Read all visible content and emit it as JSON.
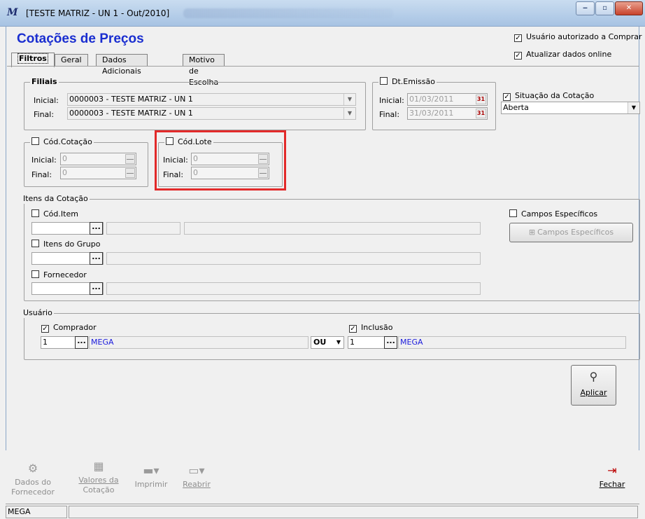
{
  "window": {
    "title": "[TESTE MATRIZ - UN 1 - Out/2010]",
    "buttons": {
      "minimize": "‒",
      "maximize": "▫",
      "close": "✕"
    }
  },
  "page": {
    "heading": "Cotações de Preços"
  },
  "top_right": {
    "usuario_autorizado": {
      "label": "Usuário autorizado a Comprar",
      "checked": true,
      "mark": "✓"
    },
    "atualizar_online": {
      "label": "Atualizar dados online",
      "checked": true,
      "mark": "✓"
    }
  },
  "tabs": [
    {
      "label": "Filtros",
      "active": true
    },
    {
      "label": "Geral",
      "active": false
    },
    {
      "label": "Dados Adicionais",
      "active": false
    },
    {
      "label": "Motivo de Escolha",
      "active": false
    }
  ],
  "filiais": {
    "legend": "Filiais",
    "inicial_label": "Inicial:",
    "inicial_value": "0000003 - TESTE MATRIZ - UN 1",
    "final_label": "Final:",
    "final_value": "0000003 - TESTE MATRIZ - UN 1"
  },
  "dt_emissao": {
    "legend": "Dt.Emissão",
    "checked": false,
    "inicial_label": "Inicial:",
    "inicial_value": "01/03/2011",
    "final_label": "Final:",
    "final_value": "31/03/2011"
  },
  "situacao": {
    "label": "Situação da Cotação",
    "checked": true,
    "mark": "✓",
    "value": "Aberta"
  },
  "cod_cotacao": {
    "legend": "Cód.Cotação",
    "checked": false,
    "inicial_label": "Inicial:",
    "inicial_value": "0",
    "final_label": "Final:",
    "final_value": "0"
  },
  "cod_lote": {
    "legend": "Cód.Lote",
    "checked": false,
    "inicial_label": "Inicial:",
    "inicial_value": "0",
    "final_label": "Final:",
    "final_value": "0"
  },
  "itens": {
    "legend": "Itens da Cotação",
    "cod_item": {
      "label": "Cód.Item",
      "checked": false
    },
    "itens_grupo": {
      "label": "Itens do Grupo",
      "checked": false
    },
    "fornecedor": {
      "label": "Fornecedor",
      "checked": false
    },
    "campos_especificos_check": {
      "label": "Campos Específicos",
      "checked": false
    },
    "campos_especificos_button": "Campos Específicos",
    "ellipsis": "..."
  },
  "usuario": {
    "legend": "Usuário",
    "comprador": {
      "label": "Comprador",
      "checked": true,
      "mark": "✓",
      "code": "1",
      "name": "MEGA"
    },
    "operator": "OU",
    "inclusao": {
      "label": "Inclusão",
      "checked": true,
      "mark": "✓",
      "code": "1",
      "name": "MEGA"
    },
    "ellipsis": "..."
  },
  "aplicar": {
    "label": "Aplicar"
  },
  "footer": {
    "dados_fornecedor": [
      "Dados do",
      "Fornecedor"
    ],
    "valores_cotacao": [
      "Valores da",
      "Cotação"
    ],
    "imprimir": "Imprimir",
    "reabrir": "Reabrir",
    "fechar": "Fechar"
  },
  "status": {
    "user": "MEGA"
  }
}
